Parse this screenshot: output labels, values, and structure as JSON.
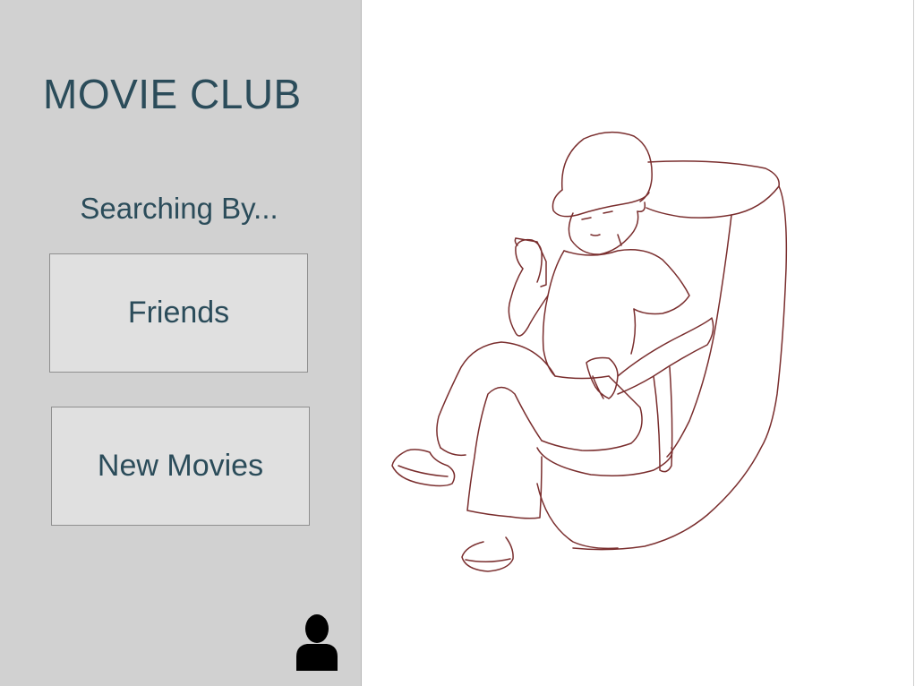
{
  "app": {
    "title": "MOVIE CLUB"
  },
  "sidebar": {
    "search_label": "Searching By...",
    "options": [
      {
        "label": "Friends"
      },
      {
        "label": "New Movies"
      }
    ],
    "profile_icon": "user-icon"
  },
  "content": {
    "illustration": "person-in-armchair-with-phone"
  },
  "colors": {
    "sidebar_bg": "#d1d1d1",
    "button_bg": "#e0e0e0",
    "text": "#2b4c5a",
    "sketch_line": "#7a2e2e"
  }
}
